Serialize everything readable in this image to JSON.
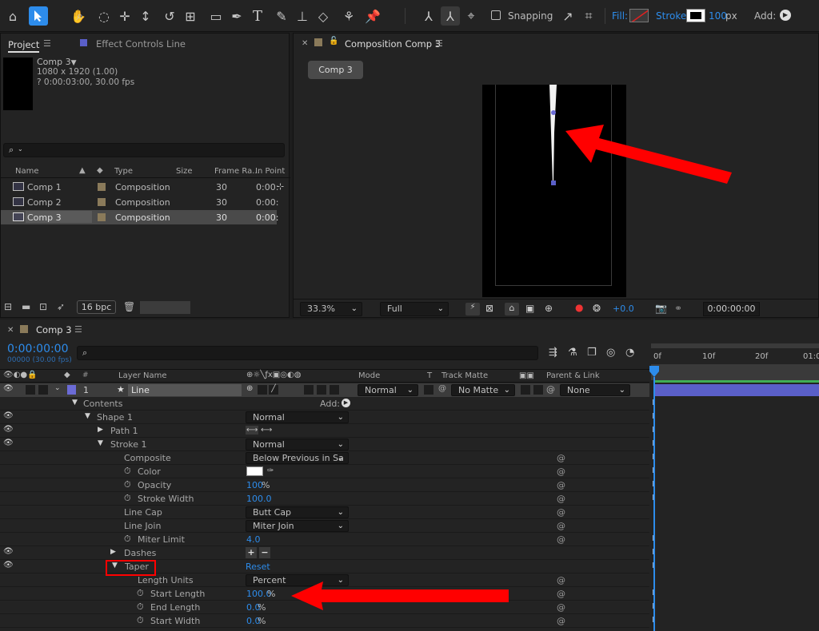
{
  "toolbar": {
    "snapping_label": "Snapping",
    "fill_label": "Fill:",
    "stroke_label": "Stroke:",
    "stroke_width_value": "100",
    "stroke_width_unit": "px",
    "add_label": "Add:"
  },
  "project_panel": {
    "tab_project": "Project",
    "tab_effect_controls": "Effect Controls Line",
    "selected_name": "Comp 3",
    "selected_dimensions": "1080 x 1920 (1.00)",
    "selected_duration": "? 0:00:03:00, 30.00 fps",
    "columns": [
      "Name",
      "Type",
      "Size",
      "Frame Ra...",
      "In Point"
    ],
    "items": [
      {
        "name": "Comp 1",
        "type": "Composition",
        "frame_rate": "30",
        "in_point": "0:00:"
      },
      {
        "name": "Comp 2",
        "type": "Composition",
        "frame_rate": "30",
        "in_point": "0:00:"
      },
      {
        "name": "Comp 3",
        "type": "Composition",
        "frame_rate": "30",
        "in_point": "0:00:"
      }
    ],
    "bpc_label": "16 bpc"
  },
  "composition_panel": {
    "tab_title": "Composition Comp 3",
    "breadcrumb": "Comp 3",
    "zoom": "33.3%",
    "resolution": "Full",
    "exposure": "+0.0",
    "timecode": "0:00:00:00"
  },
  "timeline": {
    "tab_title": "Comp 3",
    "current_time": "0:00:00:00",
    "current_frame": "00000 (30.00 fps)",
    "column_headers": {
      "layer_name": "Layer Name",
      "mode": "Mode",
      "t": "T",
      "track_matte": "Track Matte",
      "parent_link": "Parent & Link",
      "hash": "#"
    },
    "ruler_labels": [
      "0f",
      "10f",
      "20f",
      "01:0"
    ],
    "layer": {
      "number": "1",
      "name": "Line",
      "mode": "Normal",
      "track_matte": "No Matte",
      "parent": "None"
    },
    "properties": {
      "contents": "Contents",
      "add": "Add:",
      "shape1": "Shape 1",
      "shape1_blend": "Normal",
      "path1": "Path 1",
      "stroke1": "Stroke 1",
      "stroke1_blend": "Normal",
      "composite": "Composite",
      "composite_value": "Below Previous in Sa",
      "color": "Color",
      "opacity": "Opacity",
      "opacity_value": "100",
      "opacity_unit": "%",
      "stroke_width": "Stroke Width",
      "stroke_width_value": "100.0",
      "line_cap": "Line Cap",
      "line_cap_value": "Butt Cap",
      "line_join": "Line Join",
      "line_join_value": "Miter Join",
      "miter_limit": "Miter Limit",
      "miter_limit_value": "4.0",
      "dashes": "Dashes",
      "taper": "Taper",
      "taper_reset": "Reset",
      "length_units": "Length Units",
      "length_units_value": "Percent",
      "start_length": "Start Length",
      "start_length_value": "100.0",
      "end_length": "End Length",
      "end_length_value": "0.0",
      "start_width": "Start Width",
      "start_width_value": "0.0",
      "percent_unit": "%"
    }
  },
  "colors": {
    "accent_blue": "#2d8ceb",
    "annotation_red": "#ff0000",
    "layer_label_blue": "#6b6bd6",
    "composition_swatch": "#8a7a5a"
  }
}
